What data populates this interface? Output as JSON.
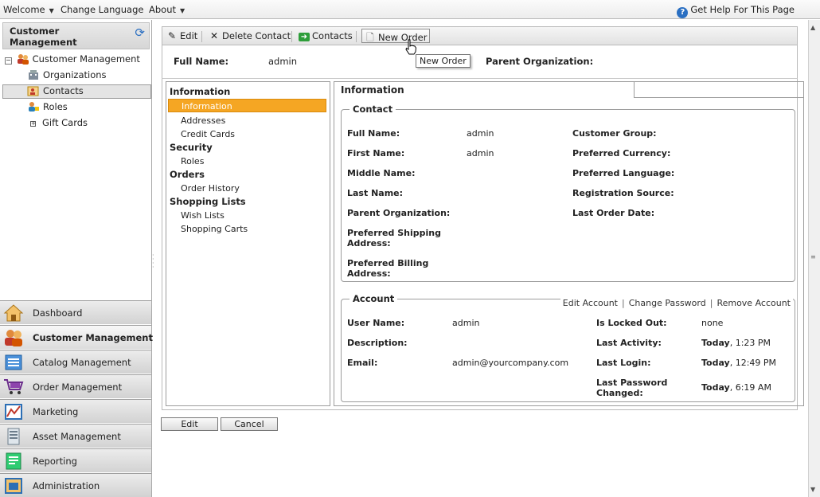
{
  "topbar": {
    "welcome": "Welcome",
    "change_language": "Change Language",
    "about": "About",
    "help": "Get Help For This Page"
  },
  "sidebar": {
    "title": "Customer Management",
    "tree": [
      {
        "label": "Customer Management",
        "icon": "customers-icon"
      },
      {
        "label": "Organizations",
        "icon": "organizations-icon"
      },
      {
        "label": "Contacts",
        "icon": "contacts-icon",
        "selected": true
      },
      {
        "label": "Roles",
        "icon": "roles-icon"
      },
      {
        "label": "Gift Cards",
        "icon": "gift-cards-icon"
      }
    ],
    "modules": [
      {
        "label": "Dashboard",
        "icon": "dashboard-icon"
      },
      {
        "label": "Customer Management",
        "icon": "customer-management-icon",
        "active": true
      },
      {
        "label": "Catalog Management",
        "icon": "catalog-icon"
      },
      {
        "label": "Order Management",
        "icon": "cart-icon"
      },
      {
        "label": "Marketing",
        "icon": "marketing-icon"
      },
      {
        "label": "Asset Management",
        "icon": "asset-icon"
      },
      {
        "label": "Reporting",
        "icon": "reporting-icon"
      },
      {
        "label": "Administration",
        "icon": "administration-icon"
      }
    ]
  },
  "toolbar": {
    "edit": "Edit",
    "delete_contact": "Delete Contact",
    "contacts": "Contacts",
    "new_order": "New Order",
    "tooltip": "New Order"
  },
  "header": {
    "full_name_label": "Full Name:",
    "full_name_value": "admin",
    "parent_org_label": "Parent Organization:"
  },
  "nav": {
    "groups": [
      {
        "label": "Information",
        "items": [
          "Information",
          "Addresses",
          "Credit Cards"
        ]
      },
      {
        "label": "Security",
        "items": [
          "Roles"
        ]
      },
      {
        "label": "Orders",
        "items": [
          "Order History"
        ]
      },
      {
        "label": "Shopping Lists",
        "items": [
          "Wish Lists",
          "Shopping Carts"
        ]
      }
    ],
    "selected": "Information"
  },
  "info": {
    "tab_label": "Information",
    "contact": {
      "legend": "Contact",
      "full_name_label": "Full Name:",
      "full_name_value": "admin",
      "first_name_label": "First Name:",
      "first_name_value": "admin",
      "middle_name_label": "Middle Name:",
      "last_name_label": "Last Name:",
      "parent_org_label": "Parent Organization:",
      "pref_shipping_label_1": "Preferred Shipping",
      "pref_shipping_label_2": "Address:",
      "pref_billing_label_1": "Preferred Billing",
      "pref_billing_label_2": "Address:",
      "customer_group_label": "Customer Group:",
      "pref_currency_label": "Preferred Currency:",
      "pref_language_label": "Preferred Language:",
      "registration_source_label": "Registration Source:",
      "last_order_date_label": "Last Order Date:"
    },
    "account": {
      "legend": "Account",
      "edit_account": "Edit Account",
      "change_password": "Change Password",
      "remove_account": "Remove Account",
      "sep": "|",
      "user_name_label": "User Name:",
      "user_name_value": "admin",
      "description_label": "Description:",
      "email_label": "Email:",
      "email_value": "admin@yourcompany.com",
      "locked_out_label": "Is Locked Out:",
      "locked_out_value": "none",
      "last_activity_label": "Last Activity:",
      "last_activity_day": "Today",
      "last_activity_time": ", 1:23 PM",
      "last_login_label": "Last Login:",
      "last_login_day": "Today",
      "last_login_time": ", 12:49 PM",
      "last_pw_label_1": "Last Password",
      "last_pw_label_2": "Changed:",
      "last_pw_day": "Today",
      "last_pw_time": ", 6:19 AM"
    }
  },
  "footer": {
    "edit": "Edit",
    "cancel": "Cancel"
  },
  "colors": {
    "selected_nav": "#f5a623",
    "accent_blue": "#2a6fc2"
  }
}
